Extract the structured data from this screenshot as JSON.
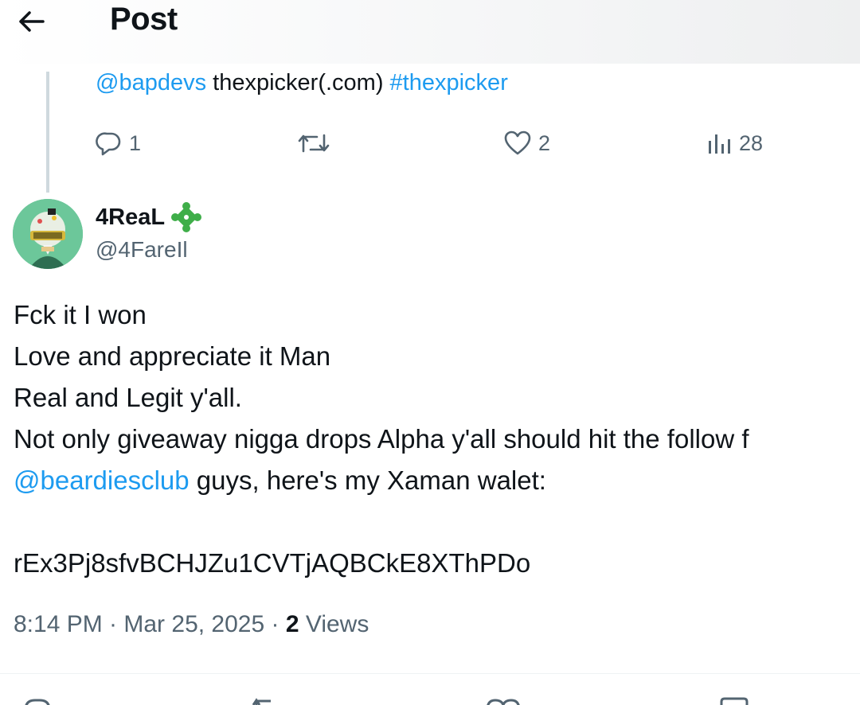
{
  "header": {
    "back_icon": "arrow-left-icon",
    "title": "Post"
  },
  "previous_post": {
    "mention": "@bapdevs",
    "text": " thexpicker(.com) ",
    "hashtag": "#thexpicker",
    "actions": {
      "reply_count": "1",
      "repost_count": "",
      "like_count": "2",
      "views_count": "28"
    }
  },
  "post": {
    "author_name": "4ReaL",
    "badge_icon": "puzzle-piece-icon",
    "author_handle": "@4FareIl",
    "lines": [
      "Fck it I won",
      "Love and appreciate it Man",
      "Real and Legit y'all.",
      "Not only giveaway nigga drops Alpha y'all should hit the follow f"
    ],
    "mention": "@beardiesclub",
    "mention_rest": " guys, here's my Xaman walet:",
    "wallet": "rEx3Pj8sfvBCHJZu1CVTjAQBCkE8XThPDo",
    "time": "8:14 PM · Mar 25, 2025 · ",
    "views_count": "2",
    "views_label": " Views"
  },
  "colors": {
    "link": "#1d9bf0",
    "secondary_text": "#536471",
    "primary_text": "#0f1419",
    "thread_line": "#cfd9de"
  }
}
